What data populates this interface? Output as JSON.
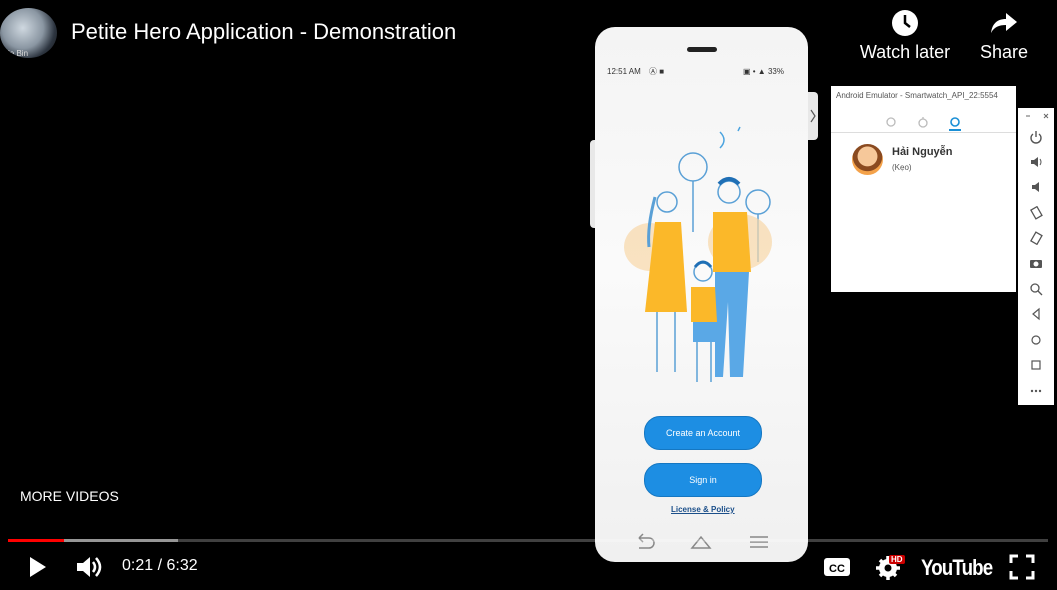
{
  "player": {
    "title": "Petite Hero Application - Demonstration",
    "channel_thumb_caption": "ycle Bin",
    "watch_later_label": "Watch later",
    "share_label": "Share",
    "more_videos_label": "MORE VIDEOS",
    "time_current": "0:21",
    "time_separator": " / ",
    "time_total": "6:32",
    "progress_played_fraction": 0.054,
    "progress_buffered_fraction": 0.163,
    "hd_badge": "HD",
    "logo_text": "YouTube",
    "accent_color": "#ff0000"
  },
  "phone": {
    "status_time": "12:51 AM",
    "status_left_icons": "Ⓐ ■",
    "status_right": "▣ • ▲ 33%",
    "create_account_label": "Create an Account",
    "sign_in_label": "Sign in",
    "license_label": "License & Policy",
    "button_color": "#1d8ee3"
  },
  "watch": {
    "window_title": "Android Emulator - Smartwatch_API_22:5554",
    "contact_name": "Hải Nguyễn",
    "contact_nick": "(Kẹo)"
  },
  "emulator_toolbar": {
    "icons": [
      "power-icon",
      "volume-up-icon",
      "volume-down-icon",
      "rotate-left-icon",
      "rotate-right-icon",
      "camera-icon",
      "zoom-icon",
      "back-icon",
      "home-icon",
      "overview-icon",
      "more-icon"
    ]
  }
}
